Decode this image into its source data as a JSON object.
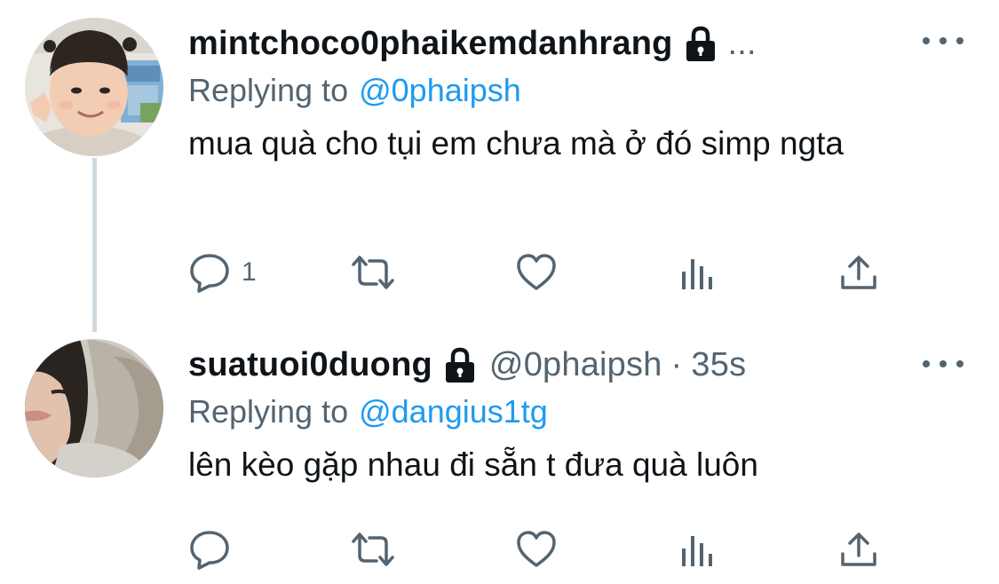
{
  "tweets": [
    {
      "display_name": "mintchoco0phaikemdanhrang",
      "truncated_indicator": "...",
      "handle": "",
      "separator": "",
      "time": "",
      "replying_prefix": "Replying to",
      "replying_to": "@0phaipsh",
      "text": "mua quà cho tụi em chưa mà ở đó simp ngta",
      "reply_count": "1",
      "icons": [
        "lock-icon",
        "more-icon",
        "reply-icon",
        "retweet-icon",
        "like-icon",
        "analytics-icon",
        "share-icon"
      ]
    },
    {
      "display_name": "suatuoi0duong",
      "truncated_indicator": "",
      "handle": "@0phaipsh",
      "separator": "·",
      "time": "35s",
      "replying_prefix": "Replying to",
      "replying_to": "@dangius1tg",
      "text": "lên kèo gặp nhau đi sẵn t đưa quà luôn",
      "reply_count": "",
      "icons": [
        "lock-icon",
        "more-icon",
        "reply-icon",
        "retweet-icon",
        "like-icon",
        "analytics-icon",
        "share-icon"
      ]
    }
  ],
  "colors": {
    "text_primary": "#0f1419",
    "text_secondary": "#536471",
    "link": "#1d9bf0",
    "thread_line": "#cfd9de",
    "background": "#ffffff"
  }
}
